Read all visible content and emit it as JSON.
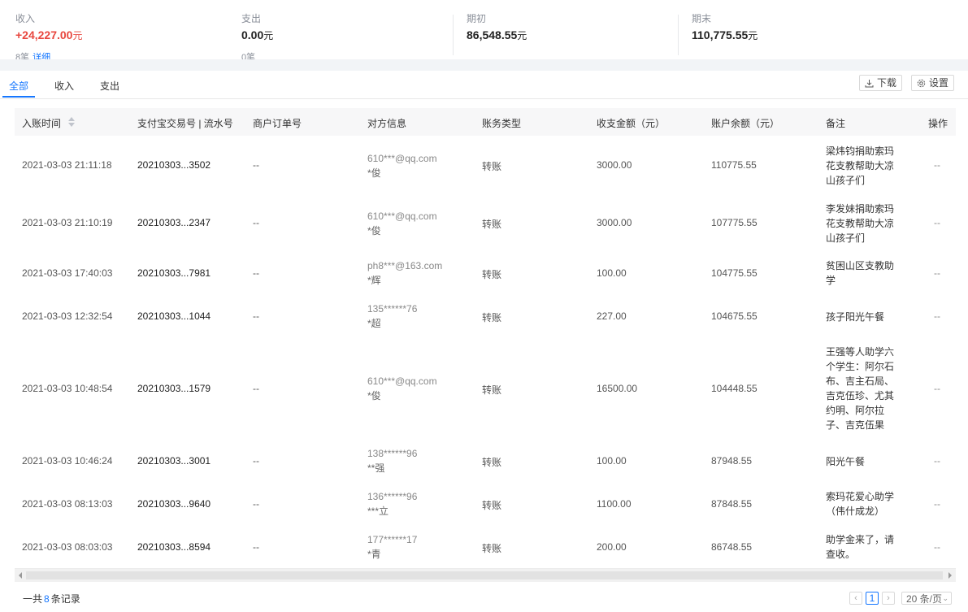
{
  "summary": {
    "income": {
      "label": "收入",
      "value": "+24,227.00",
      "unit": "元",
      "sub_count": "8笔",
      "sub_link": "详细"
    },
    "expense": {
      "label": "支出",
      "value": "0.00",
      "unit": "元",
      "sub_count": "0笔"
    },
    "opening": {
      "label": "期初",
      "value": "86,548.55",
      "unit": "元"
    },
    "closing": {
      "label": "期末",
      "value": "110,775.55",
      "unit": "元"
    }
  },
  "tabs": [
    {
      "label": "全部",
      "active": true
    },
    {
      "label": "收入",
      "active": false
    },
    {
      "label": "支出",
      "active": false
    }
  ],
  "toolbar": {
    "download_label": "下载",
    "settings_label": "设置"
  },
  "table": {
    "columns": [
      "入账时间",
      "支付宝交易号 | 流水号",
      "商户订单号",
      "对方信息",
      "账务类型",
      "收支金额（元）",
      "账户余额（元）",
      "备注",
      "操作"
    ],
    "rows": [
      {
        "time": "2021-03-03 21:11:18",
        "serial": "20210303...3502",
        "order": "--",
        "cp_email": "610***@qq.com",
        "cp_name": "*俊",
        "type": "转账",
        "amount": "3000.00",
        "balance": "110775.55",
        "note": "梁炜钧捐助索玛花支教帮助大凉山孩子们",
        "ops": "--"
      },
      {
        "time": "2021-03-03 21:10:19",
        "serial": "20210303...2347",
        "order": "--",
        "cp_email": "610***@qq.com",
        "cp_name": "*俊",
        "type": "转账",
        "amount": "3000.00",
        "balance": "107775.55",
        "note": "李发妹捐助索玛花支教帮助大凉山孩子们",
        "ops": "--"
      },
      {
        "time": "2021-03-03 17:40:03",
        "serial": "20210303...7981",
        "order": "--",
        "cp_email": "ph8***@163.com",
        "cp_name": "*辉",
        "type": "转账",
        "amount": "100.00",
        "balance": "104775.55",
        "note": "贫困山区支教助学",
        "ops": "--"
      },
      {
        "time": "2021-03-03 12:32:54",
        "serial": "20210303...1044",
        "order": "--",
        "cp_email": "135******76",
        "cp_name": "*超",
        "type": "转账",
        "amount": "227.00",
        "balance": "104675.55",
        "note": "孩子阳光午餐",
        "ops": "--"
      },
      {
        "time": "2021-03-03 10:48:54",
        "serial": "20210303...1579",
        "order": "--",
        "cp_email": "610***@qq.com",
        "cp_name": "*俊",
        "type": "转账",
        "amount": "16500.00",
        "balance": "104448.55",
        "note": "王强等人助学六个学生：阿尔石布、吉主石局、吉克伍珍、尤其约明、阿尔拉子、吉克伍果",
        "ops": "--"
      },
      {
        "time": "2021-03-03 10:46:24",
        "serial": "20210303...3001",
        "order": "--",
        "cp_email": "138******96",
        "cp_name": "**强",
        "type": "转账",
        "amount": "100.00",
        "balance": "87948.55",
        "note": "阳光午餐",
        "ops": "--"
      },
      {
        "time": "2021-03-03 08:13:03",
        "serial": "20210303...9640",
        "order": "--",
        "cp_email": "136******96",
        "cp_name": "***立",
        "type": "转账",
        "amount": "1100.00",
        "balance": "87848.55",
        "note": "索玛花爱心助学（伟什成龙）",
        "ops": "--"
      },
      {
        "time": "2021-03-03 08:03:03",
        "serial": "20210303...8594",
        "order": "--",
        "cp_email": "177******17",
        "cp_name": "*青",
        "type": "转账",
        "amount": "200.00",
        "balance": "86748.55",
        "note": "助学金来了，请查收。",
        "ops": "--"
      }
    ]
  },
  "footer": {
    "total_prefix": "一共",
    "total_count": "8",
    "total_suffix": "条记录",
    "current_page": "1",
    "page_size": "20 条/页"
  },
  "colors": {
    "accent": "#1677ff",
    "income": "#e8473f"
  },
  "icons": {
    "sort": "sort-icon",
    "download": "download-icon",
    "settings": "gear-icon",
    "prev": "chevron-left-icon",
    "next": "chevron-right-icon",
    "page_size_dropdown": "chevron-down-icon"
  }
}
